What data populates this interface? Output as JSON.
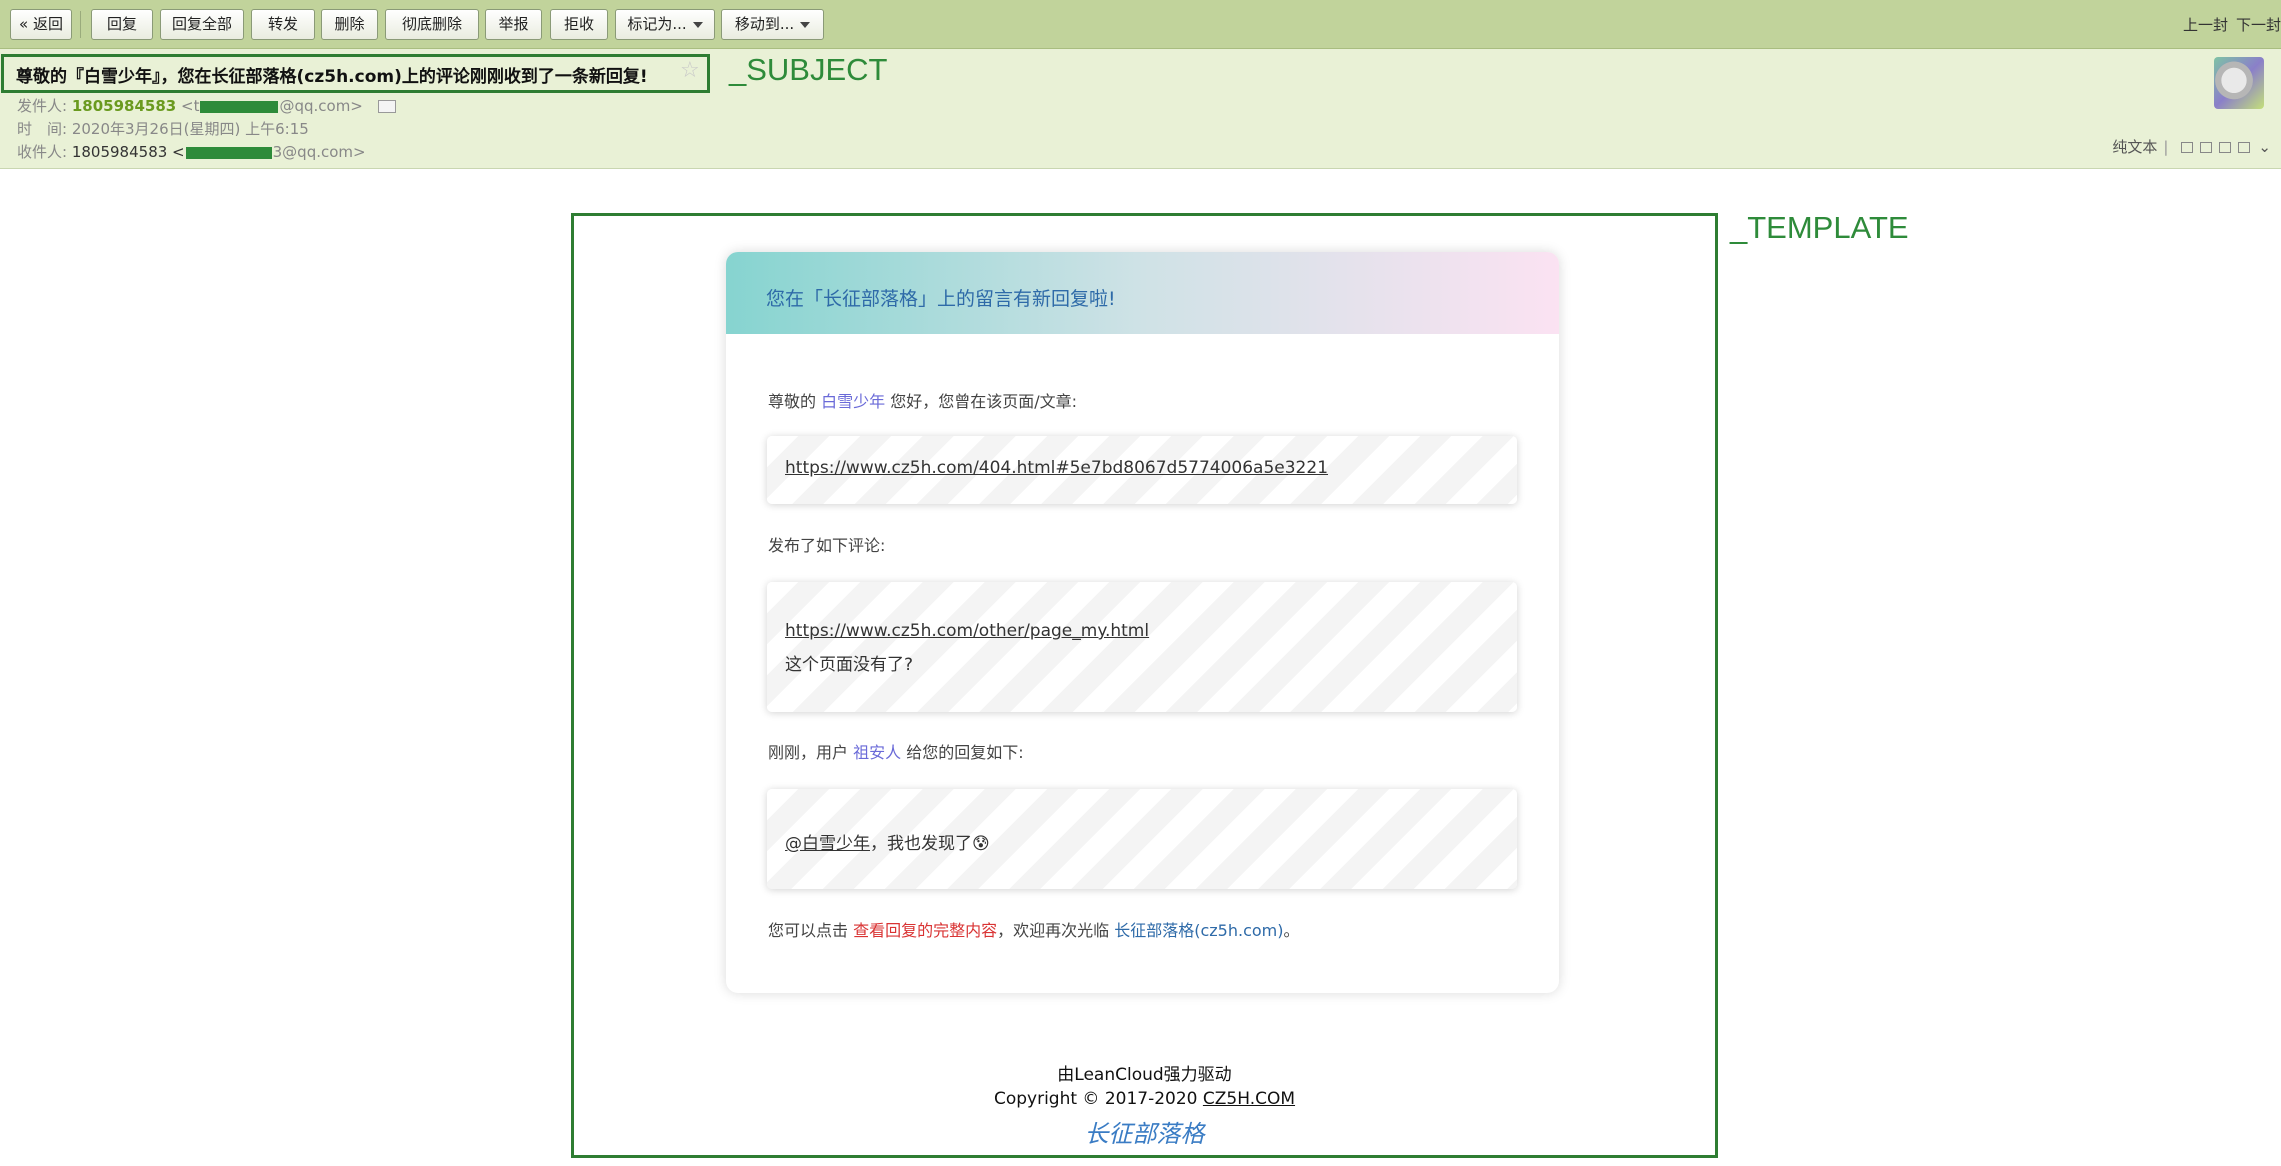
{
  "toolbar": {
    "back": "« 返回",
    "reply": "回复",
    "reply_all": "回复全部",
    "forward": "转发",
    "delete": "删除",
    "delete_perm": "彻底删除",
    "report": "举报",
    "reject": "拒收",
    "mark_as": "标记为...",
    "move_to": "移动到...",
    "prev": "上一封",
    "next": "下一封"
  },
  "header": {
    "subject": "尊敬的『白雪少年』，您在长征部落格(cz5h.com)上的评论刚刚收到了一条新回复!",
    "subject_tag": "_SUBJECT",
    "from_label": "发件人:",
    "from_name": "1805984583",
    "from_addr_prefix": "<t",
    "from_addr_suffix": "@qq.com>",
    "time_label": "时　间:",
    "time_value": "2020年3月26日(星期四) 上午6:15",
    "to_label": "收件人:",
    "to_name": "1805984583 <",
    "to_addr_suffix": "3@qq.com>",
    "plain_text": "纯文本"
  },
  "template_tag": "_TEMPLATE",
  "card": {
    "title": "您在「长征部落格」上的留言有新回复啦!",
    "greeting_prefix": "尊敬的",
    "greeting_name": "白雪少年",
    "greeting_suffix": "您好，您曾在该页面/文章:",
    "page_url": "https://www.cz5h.com/404.html#5e7bd8067d5774006a5e3221",
    "posted_label": "发布了如下评论:",
    "comment_url": "https://www.cz5h.com/other/page_my.html",
    "comment_text": "这个页面没有了?",
    "reply_prefix": "刚刚，用户",
    "reply_user": "祖安人",
    "reply_suffix": "给您的回复如下:",
    "reply_mention": "@白雪少年",
    "reply_text": "，我也发现了😰",
    "bottom_prefix": "您可以点击",
    "bottom_link1": "查看回复的完整内容",
    "bottom_mid": "，欢迎再次光临",
    "bottom_link2": "长征部落格(cz5h.com)",
    "bottom_end": "。"
  },
  "footer": {
    "powered": "由LeanCloud强力驱动",
    "copyright_prefix": "Copyright © 2017-2020",
    "copyright_site": "CZ5H.COM",
    "logo_text": "长征部落格"
  },
  "colors": {
    "toolbar_bg": "#c1d39b",
    "header_bg": "#e9f1d6",
    "annotation_green": "#2e8b3a",
    "link_blue": "#2e6aa8",
    "link_red": "#d93333"
  }
}
